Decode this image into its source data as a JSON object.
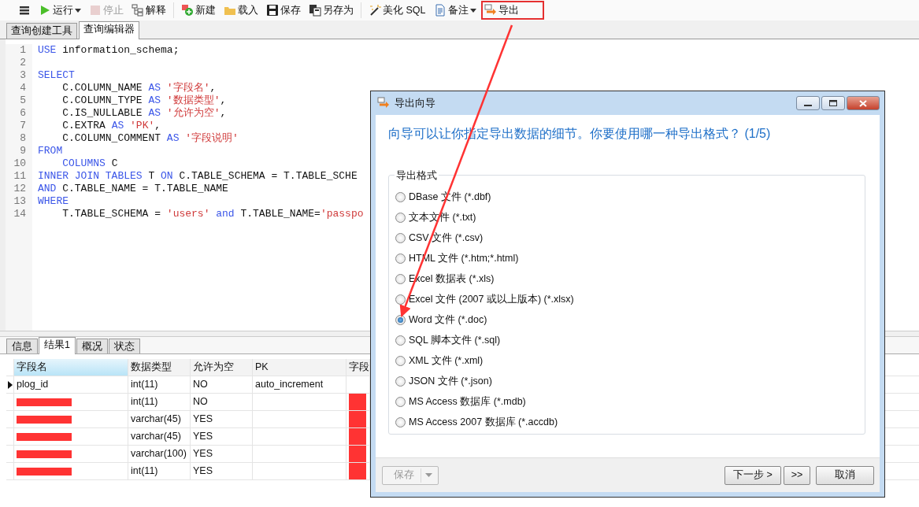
{
  "toolbar": {
    "groups": [
      {
        "items": [
          {
            "kind": "menu",
            "disabled": false,
            "dropdown": false
          },
          {
            "kind": "run",
            "label": "运行",
            "disabled": false,
            "dropdown": true
          },
          {
            "kind": "stop",
            "label": "停止",
            "disabled": true,
            "dropdown": false
          },
          {
            "kind": "explain",
            "label": "解释",
            "disabled": false,
            "dropdown": false
          }
        ]
      },
      {
        "items": [
          {
            "kind": "new",
            "label": "新建",
            "disabled": false,
            "dropdown": false
          },
          {
            "kind": "load",
            "label": "载入",
            "disabled": false,
            "dropdown": false
          },
          {
            "kind": "save",
            "label": "保存",
            "disabled": false,
            "dropdown": false
          },
          {
            "kind": "saveas",
            "label": "另存为",
            "disabled": false,
            "dropdown": false
          }
        ]
      },
      {
        "items": [
          {
            "kind": "beautify",
            "label": "美化 SQL",
            "disabled": false,
            "dropdown": false
          },
          {
            "kind": "note",
            "label": "备注",
            "disabled": false,
            "dropdown": true
          },
          {
            "kind": "export",
            "label": "导出",
            "disabled": false,
            "dropdown": false,
            "highlighted": true
          }
        ]
      }
    ]
  },
  "editor_tabs": [
    {
      "label": "查询创建工具",
      "selected": false
    },
    {
      "label": "查询编辑器",
      "selected": true
    }
  ],
  "code_lines": [
    {
      "number": "1",
      "tokens": [
        {
          "kind": "keyword",
          "text": "USE"
        },
        {
          "kind": "plain",
          "text": " information_schema;"
        }
      ]
    },
    {
      "number": "2"
    },
    {
      "number": "3",
      "tokens": [
        {
          "kind": "keyword",
          "text": "SELECT"
        }
      ]
    },
    {
      "number": "4",
      "tokens": [
        {
          "kind": "plain",
          "text": "    C.COLUMN_NAME "
        },
        {
          "kind": "keyword",
          "text": "AS"
        },
        {
          "kind": "string",
          "text": " '字段名'"
        },
        {
          "kind": "plain",
          "text": ","
        }
      ]
    },
    {
      "number": "5",
      "tokens": [
        {
          "kind": "plain",
          "text": "    C.COLUMN_TYPE "
        },
        {
          "kind": "keyword",
          "text": "AS"
        },
        {
          "kind": "string",
          "text": " '数据类型'"
        },
        {
          "kind": "plain",
          "text": ","
        }
      ]
    },
    {
      "number": "6",
      "tokens": [
        {
          "kind": "plain",
          "text": "    C.IS_NULLABLE "
        },
        {
          "kind": "keyword",
          "text": "AS"
        },
        {
          "kind": "string",
          "text": " '允许为空'"
        },
        {
          "kind": "plain",
          "text": ","
        }
      ]
    },
    {
      "number": "7",
      "tokens": [
        {
          "kind": "plain",
          "text": "    C.EXTRA "
        },
        {
          "kind": "keyword",
          "text": "AS"
        },
        {
          "kind": "string",
          "text": " 'PK'"
        },
        {
          "kind": "plain",
          "text": ","
        }
      ]
    },
    {
      "number": "8",
      "tokens": [
        {
          "kind": "plain",
          "text": "    C.COLUMN_COMMENT "
        },
        {
          "kind": "keyword",
          "text": "AS"
        },
        {
          "kind": "string",
          "text": " '字段说明'"
        }
      ]
    },
    {
      "number": "9",
      "tokens": [
        {
          "kind": "keyword",
          "text": "FROM"
        }
      ]
    },
    {
      "number": "10",
      "tokens": [
        {
          "kind": "keyword",
          "text": "    COLUMNS"
        },
        {
          "kind": "plain",
          "text": " C"
        }
      ]
    },
    {
      "number": "11",
      "tokens": [
        {
          "kind": "keyword",
          "text": "INNER JOIN TABLES"
        },
        {
          "kind": "plain",
          "text": " T "
        },
        {
          "kind": "keyword",
          "text": "ON"
        },
        {
          "kind": "plain",
          "text": " C.TABLE_SCHEMA = T.TABLE_SCHE"
        }
      ]
    },
    {
      "number": "12",
      "tokens": [
        {
          "kind": "keyword",
          "text": "AND"
        },
        {
          "kind": "plain",
          "text": " C.TABLE_NAME = T.TABLE_NAME"
        }
      ]
    },
    {
      "number": "13",
      "tokens": [
        {
          "kind": "keyword",
          "text": "WHERE"
        }
      ]
    },
    {
      "number": "14",
      "tokens": [
        {
          "kind": "plain",
          "text": "    T.TABLE_SCHEMA = "
        },
        {
          "kind": "string",
          "text": "'users'"
        },
        {
          "kind": "keyword",
          "text": " and "
        },
        {
          "kind": "plain",
          "text": "T.TABLE_NAME="
        },
        {
          "kind": "string",
          "text": "'passpo"
        }
      ]
    }
  ],
  "result_tabs": [
    {
      "label": "信息",
      "selected": false
    },
    {
      "label": "结果1",
      "selected": true
    },
    {
      "label": "概况",
      "selected": false
    },
    {
      "label": "状态",
      "selected": false
    }
  ],
  "table": {
    "columns": [
      {
        "label": "字段名",
        "selected": true
      },
      {
        "label": "数据类型",
        "selected": false
      },
      {
        "label": "允许为空",
        "selected": false
      },
      {
        "label": "PK",
        "selected": false
      },
      {
        "label": "字段",
        "selected": false
      }
    ],
    "rows": [
      {
        "current": true,
        "cells": [
          {
            "text": "plog_id"
          },
          {
            "text": "int(11)"
          },
          {
            "text": "NO"
          },
          {
            "text": "auto_increment"
          },
          {}
        ]
      },
      {
        "current": false,
        "cells": [
          {
            "redacted": true
          },
          {
            "text": "int(11)"
          },
          {
            "text": "NO"
          },
          {},
          {
            "redacted": true
          }
        ]
      },
      {
        "current": false,
        "cells": [
          {
            "redacted": true
          },
          {
            "text": "varchar(45)"
          },
          {
            "text": "YES"
          },
          {},
          {
            "redacted": true
          }
        ]
      },
      {
        "current": false,
        "cells": [
          {
            "redacted": true
          },
          {
            "text": "varchar(45)"
          },
          {
            "text": "YES"
          },
          {},
          {
            "redacted": true
          }
        ]
      },
      {
        "current": false,
        "cells": [
          {
            "redacted": true
          },
          {
            "text": "varchar(100)"
          },
          {
            "text": "YES"
          },
          {},
          {
            "redacted": true
          }
        ]
      },
      {
        "current": false,
        "cells": [
          {
            "redacted": true
          },
          {
            "text": "int(11)"
          },
          {
            "text": "YES"
          },
          {},
          {
            "redacted": true
          }
        ]
      }
    ]
  },
  "dialog": {
    "title": "导出向导",
    "heading": "向导可以让你指定导出数据的细节。你要使用哪一种导出格式？ (1/5)",
    "group_label": "导出格式",
    "options": [
      {
        "label": "DBase 文件 (*.dbf)",
        "selected": false
      },
      {
        "label": "文本文件 (*.txt)",
        "selected": false
      },
      {
        "label": "CSV 文件 (*.csv)",
        "selected": false
      },
      {
        "label": "HTML 文件 (*.htm;*.html)",
        "selected": false
      },
      {
        "label": "Excel 数据表 (*.xls)",
        "selected": false
      },
      {
        "label": "Excel 文件 (2007 或以上版本) (*.xlsx)",
        "selected": false
      },
      {
        "label": "Word 文件 (*.doc)",
        "selected": true
      },
      {
        "label": "SQL 脚本文件 (*.sql)",
        "selected": false
      },
      {
        "label": "XML 文件 (*.xml)",
        "selected": false
      },
      {
        "label": "JSON 文件 (*.json)",
        "selected": false
      },
      {
        "label": "MS Access 数据库 (*.mdb)",
        "selected": false
      },
      {
        "label": "MS Access 2007 数据库 (*.accdb)",
        "selected": false
      }
    ],
    "save_button": {
      "label": "保存",
      "disabled": true
    },
    "buttons": [
      {
        "label": "下一步 >",
        "kind": "next"
      },
      {
        "label": ">>",
        "kind": "finish"
      },
      {
        "label": "取消",
        "kind": "cancel"
      }
    ]
  }
}
